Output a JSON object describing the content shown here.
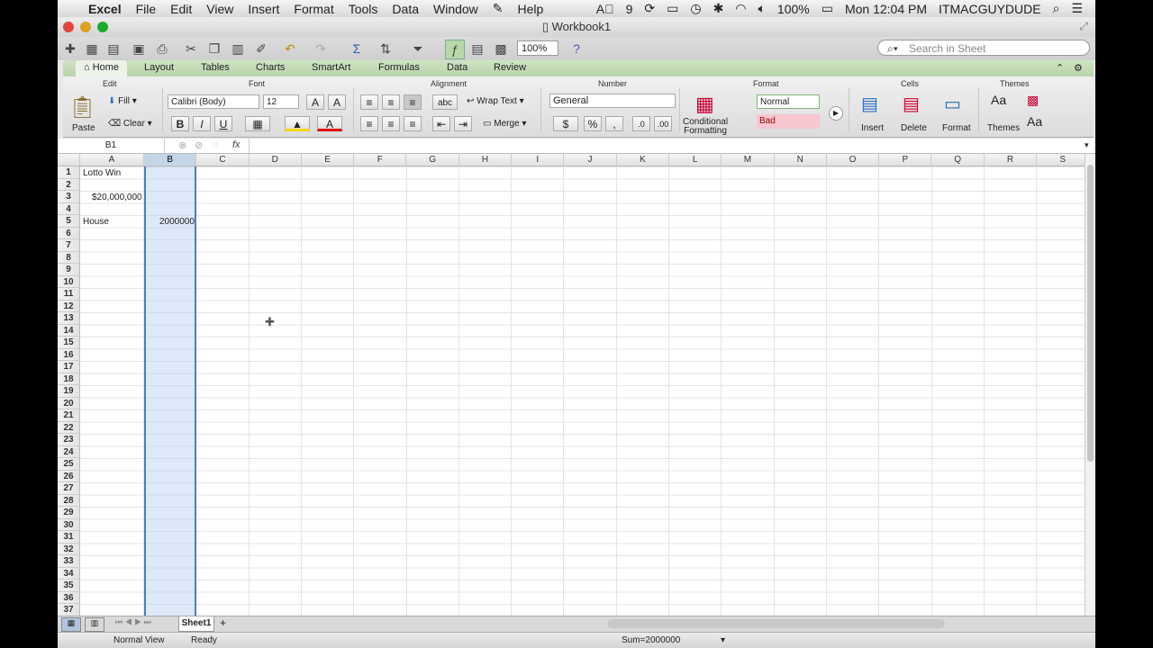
{
  "menubar": {
    "app": "Excel",
    "items": [
      "File",
      "Edit",
      "View",
      "Insert",
      "Format",
      "Tools",
      "Data",
      "Window",
      "Help"
    ],
    "status_num": "9",
    "battery": "100%",
    "clock": "Mon 12:04 PM",
    "user": "ITMACGUYDUDE"
  },
  "window": {
    "title": "Workbook1"
  },
  "toolbar": {
    "zoom": "100%",
    "search_placeholder": "Search in Sheet"
  },
  "ribbon_tabs": [
    "Home",
    "Layout",
    "Tables",
    "Charts",
    "SmartArt",
    "Formulas",
    "Data",
    "Review"
  ],
  "ribbon": {
    "groups": {
      "edit": "Edit",
      "font": "Font",
      "alignment": "Alignment",
      "number": "Number",
      "format": "Format",
      "cells": "Cells",
      "themes": "Themes"
    },
    "paste": "Paste",
    "fill": "Fill",
    "clear": "Clear",
    "font_name": "Calibri (Body)",
    "font_size": "12",
    "bold": "B",
    "italic": "I",
    "underline": "U",
    "wrap_text": "Wrap Text",
    "merge": "Merge",
    "number_format": "General",
    "percent": "%",
    "comma": ",",
    "conditional_formatting": "Conditional Formatting",
    "style_normal": "Normal",
    "style_bad": "Bad",
    "insert": "Insert",
    "delete": "Delete",
    "format": "Format",
    "themes": "Themes"
  },
  "formula_bar": {
    "cell_ref": "B1",
    "fx": "fx"
  },
  "sheet": {
    "columns": [
      "A",
      "B",
      "C",
      "D",
      "E",
      "F",
      "G",
      "H",
      "I",
      "J",
      "K",
      "L",
      "M",
      "N",
      "O",
      "P",
      "Q",
      "R",
      "S"
    ],
    "selected_column": "B",
    "cells": {
      "a1": "Lotto Win",
      "a3": "$20,000,000",
      "a5": "House",
      "b5": "2000000"
    }
  },
  "bottom": {
    "sheet_tab": "Sheet1"
  },
  "status": {
    "view": "Normal View",
    "mode": "Ready",
    "sum": "Sum=2000000"
  },
  "colors": {
    "ribbon_tab_bg": "#b9d4aa",
    "selection": "#4a7fc1",
    "bad_style": "#f7c6ce"
  }
}
